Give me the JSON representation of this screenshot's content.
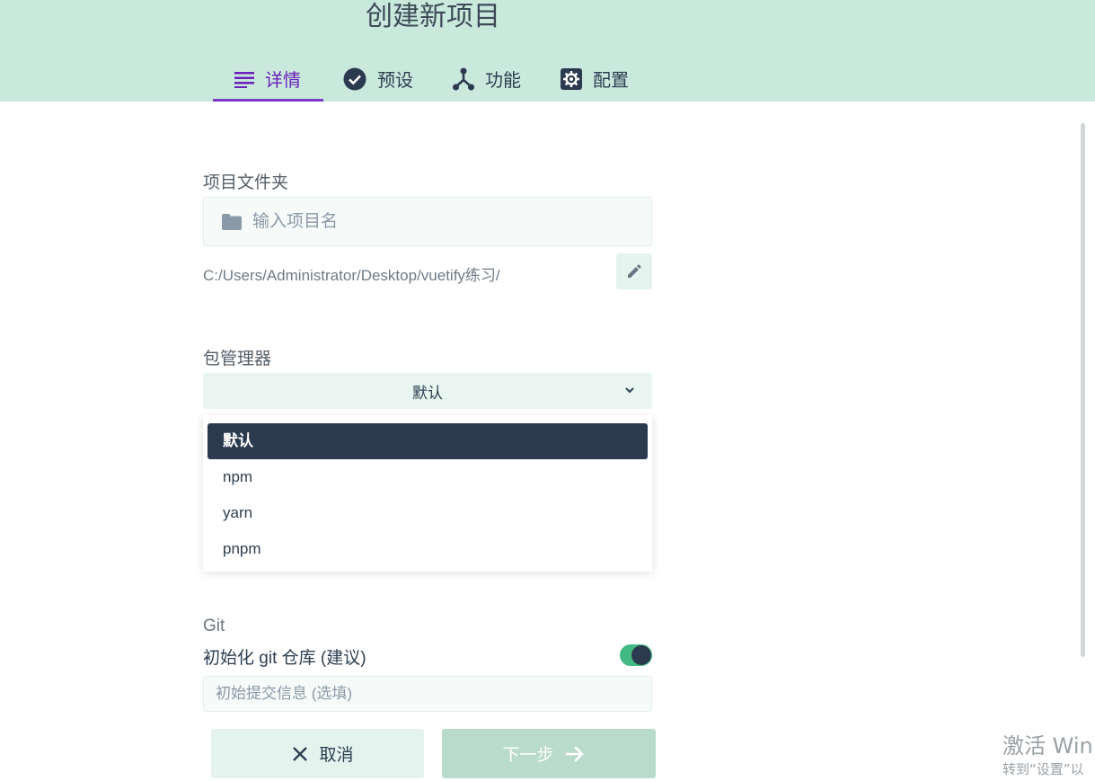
{
  "header": {
    "title": "创建新项目",
    "tabs": [
      {
        "label": "详情",
        "icon": "list-icon",
        "active": true
      },
      {
        "label": "预设",
        "icon": "check-circle-icon"
      },
      {
        "label": "功能",
        "icon": "fork-icon"
      },
      {
        "label": "配置",
        "icon": "gear-icon"
      }
    ]
  },
  "folder": {
    "label": "项目文件夹",
    "placeholder": "输入项目名",
    "icon": "folder-icon",
    "path": "C:/Users/Administrator/Desktop/vuetify练习/",
    "edit_icon": "pencil-icon"
  },
  "package_manager": {
    "label": "包管理器",
    "selected": "默认",
    "icon": "chevron-down-icon",
    "options": [
      "默认",
      "npm",
      "yarn",
      "pnpm"
    ]
  },
  "git": {
    "label": "Git",
    "init_label": "初始化 git 仓库 (建议)",
    "init_enabled": true,
    "commit_placeholder": "初始提交信息 (选填)"
  },
  "actions": {
    "cancel_label": "取消",
    "cancel_icon": "close-icon",
    "next_label": "下一步",
    "next_icon": "arrow-right-icon"
  },
  "watermark": {
    "line1": "激活 Win",
    "line2": "转到“设置”以"
  },
  "colors": {
    "header_bg": "#c9e9dd",
    "active_tab": "#6a1fb8",
    "toggle_on": "#42b983",
    "dark": "#2c3a4f"
  }
}
